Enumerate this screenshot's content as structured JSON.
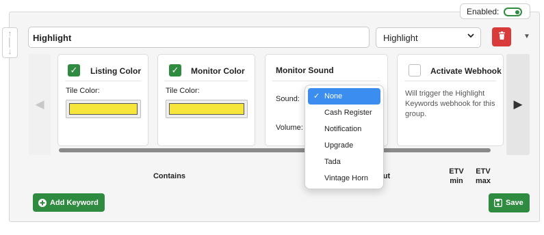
{
  "enabled": {
    "label": "Enabled:",
    "value": true
  },
  "group": {
    "name": "Highlight",
    "type_select": "Highlight"
  },
  "cards": {
    "listing_color": {
      "title": "Listing Color",
      "checked": true,
      "tile_label": "Tile Color:",
      "color": "#f6e63c"
    },
    "monitor_color": {
      "title": "Monitor Color",
      "checked": true,
      "tile_label": "Tile Color:",
      "color": "#f6e63c"
    },
    "monitor_sound": {
      "title": "Monitor Sound",
      "sound_label": "Sound:",
      "volume_label": "Volume:"
    },
    "webhook": {
      "title": "Activate Webhook",
      "checked": false,
      "hint": "Will trigger the Highlight Keywords webhook for this group."
    }
  },
  "sound_dropdown": {
    "selected": "None",
    "options": [
      "None",
      "Cash Register",
      "Notification",
      "Upgrade",
      "Tada",
      "Vintage Horn"
    ]
  },
  "table_headers": {
    "contains": "Contains",
    "without_partial": "ut",
    "etv_min": [
      "ETV",
      "min"
    ],
    "etv_max": [
      "ETV",
      "max"
    ]
  },
  "buttons": {
    "add_keyword": "Add Keyword",
    "save": "Save"
  },
  "icons": {
    "drag": "up-down-arrows-icon",
    "delete": "trash-icon",
    "collapse": "triangle-down-icon",
    "prev": "triangle-left-icon",
    "next": "triangle-right-icon",
    "add": "plus-circle-icon",
    "save": "floppy-disk-icon",
    "select": "chevron-down-icon"
  },
  "colors": {
    "accent": "#2e8b3f",
    "danger": "#d93a3a",
    "highlight": "#3b8ef0"
  }
}
